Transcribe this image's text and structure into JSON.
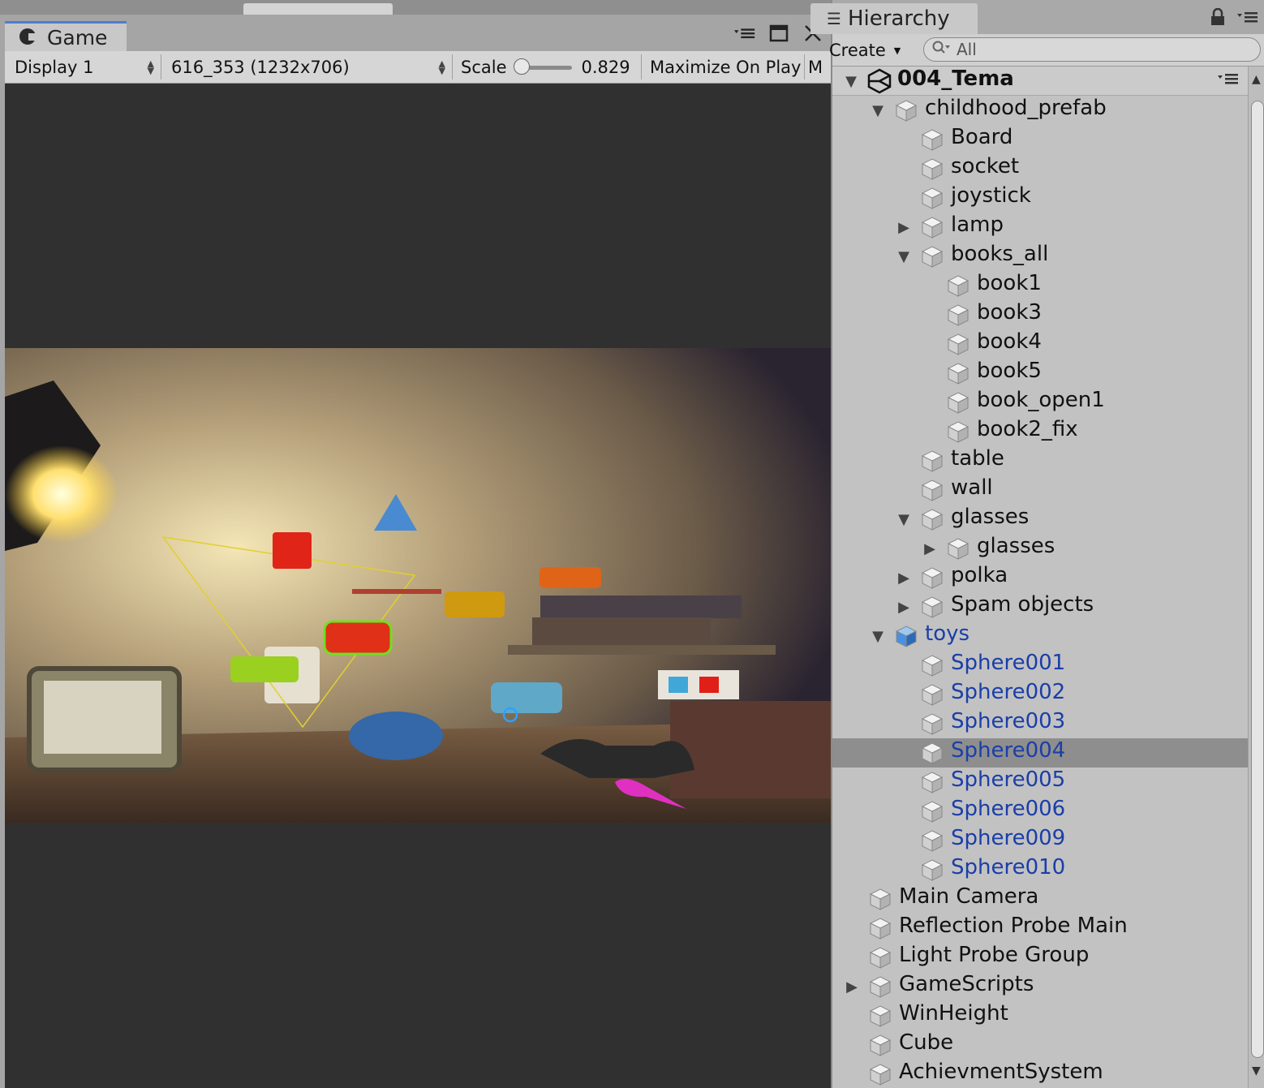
{
  "game": {
    "tab_label": "Game",
    "display": "Display 1",
    "resolution": "616_353 (1232x706)",
    "scale_label": "Scale",
    "scale_value": "0.829",
    "scale_fraction": 0.0,
    "maximize_label": "Maximize On Play",
    "overflow_label": "M"
  },
  "hierarchy": {
    "tab_label": "Hierarchy",
    "create_label": "Create",
    "search_value": "All",
    "scene": "004_Tema",
    "items": [
      {
        "label": "childhood_prefab",
        "depth": 0,
        "fold": "open",
        "prefab": false
      },
      {
        "label": "Board",
        "depth": 1,
        "fold": "none",
        "prefab": false
      },
      {
        "label": "socket",
        "depth": 1,
        "fold": "none",
        "prefab": false
      },
      {
        "label": "joystick",
        "depth": 1,
        "fold": "none",
        "prefab": false
      },
      {
        "label": "lamp",
        "depth": 1,
        "fold": "closed",
        "prefab": false
      },
      {
        "label": "books_all",
        "depth": 1,
        "fold": "open",
        "prefab": false
      },
      {
        "label": "book1",
        "depth": 2,
        "fold": "none",
        "prefab": false
      },
      {
        "label": "book3",
        "depth": 2,
        "fold": "none",
        "prefab": false
      },
      {
        "label": "book4",
        "depth": 2,
        "fold": "none",
        "prefab": false
      },
      {
        "label": "book5",
        "depth": 2,
        "fold": "none",
        "prefab": false
      },
      {
        "label": "book_open1",
        "depth": 2,
        "fold": "none",
        "prefab": false
      },
      {
        "label": "book2_fix",
        "depth": 2,
        "fold": "none",
        "prefab": false
      },
      {
        "label": "table",
        "depth": 1,
        "fold": "none",
        "prefab": false
      },
      {
        "label": "wall",
        "depth": 1,
        "fold": "none",
        "prefab": false
      },
      {
        "label": "glasses",
        "depth": 1,
        "fold": "open",
        "prefab": false
      },
      {
        "label": "glasses",
        "depth": 2,
        "fold": "closed",
        "prefab": false
      },
      {
        "label": "polka",
        "depth": 1,
        "fold": "closed",
        "prefab": false
      },
      {
        "label": "Spam objects",
        "depth": 1,
        "fold": "closed",
        "prefab": false
      },
      {
        "label": "toys",
        "depth": 0,
        "fold": "open",
        "prefab": true,
        "blue_icon": true
      },
      {
        "label": "Sphere001",
        "depth": 1,
        "fold": "none",
        "prefab": true
      },
      {
        "label": "Sphere002",
        "depth": 1,
        "fold": "none",
        "prefab": true
      },
      {
        "label": "Sphere003",
        "depth": 1,
        "fold": "none",
        "prefab": true
      },
      {
        "label": "Sphere004",
        "depth": 1,
        "fold": "none",
        "prefab": true,
        "selected": true
      },
      {
        "label": "Sphere005",
        "depth": 1,
        "fold": "none",
        "prefab": true
      },
      {
        "label": "Sphere006",
        "depth": 1,
        "fold": "none",
        "prefab": true
      },
      {
        "label": "Sphere009",
        "depth": 1,
        "fold": "none",
        "prefab": true
      },
      {
        "label": "Sphere010",
        "depth": 1,
        "fold": "none",
        "prefab": true
      },
      {
        "label": "Main Camera",
        "depth": -1,
        "fold": "none",
        "prefab": false
      },
      {
        "label": "Reflection Probe Main",
        "depth": -1,
        "fold": "none",
        "prefab": false
      },
      {
        "label": "Light Probe Group",
        "depth": -1,
        "fold": "none",
        "prefab": false
      },
      {
        "label": "GameScripts",
        "depth": -1,
        "fold": "closed",
        "prefab": false
      },
      {
        "label": "WinHeight",
        "depth": -1,
        "fold": "none",
        "prefab": false
      },
      {
        "label": "Cube",
        "depth": -1,
        "fold": "none",
        "prefab": false
      },
      {
        "label": "AchievmentSystem",
        "depth": -1,
        "fold": "none",
        "prefab": false
      }
    ]
  },
  "colors": {
    "accent_tab": "#4a7fd0",
    "prefab_text": "#1b3ea8",
    "selection": "#8e8e8e"
  }
}
